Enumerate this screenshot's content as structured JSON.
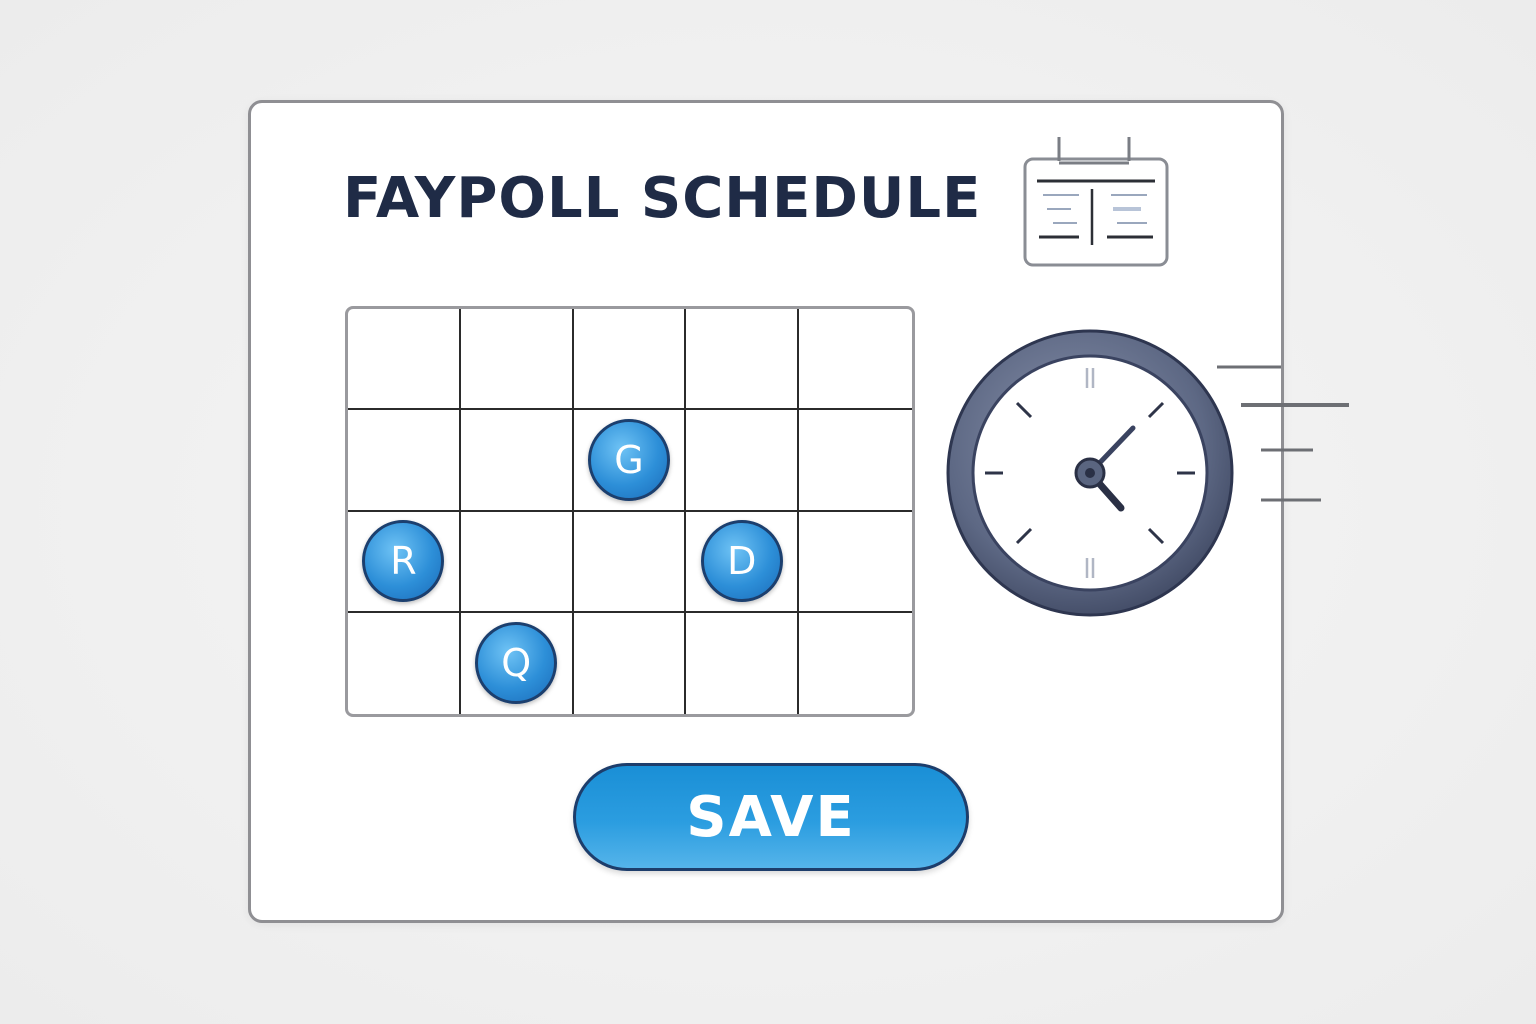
{
  "header": {
    "title": "FAYPOLL SCHEDULE"
  },
  "grid": {
    "columns": 5,
    "rows": 4,
    "markers": [
      {
        "row": 2,
        "col": 3,
        "glyph": "G"
      },
      {
        "row": 3,
        "col": 1,
        "glyph": "R"
      },
      {
        "row": 3,
        "col": 4,
        "glyph": "D"
      },
      {
        "row": 4,
        "col": 2,
        "glyph": "Q"
      }
    ]
  },
  "actions": {
    "save_label": "SAVE"
  },
  "colors": {
    "accent": "#2b9de0",
    "title": "#1f2b46",
    "clock_ring": "#5a6580"
  },
  "icons": {
    "calendar": "calendar-icon",
    "clock": "clock-icon"
  }
}
